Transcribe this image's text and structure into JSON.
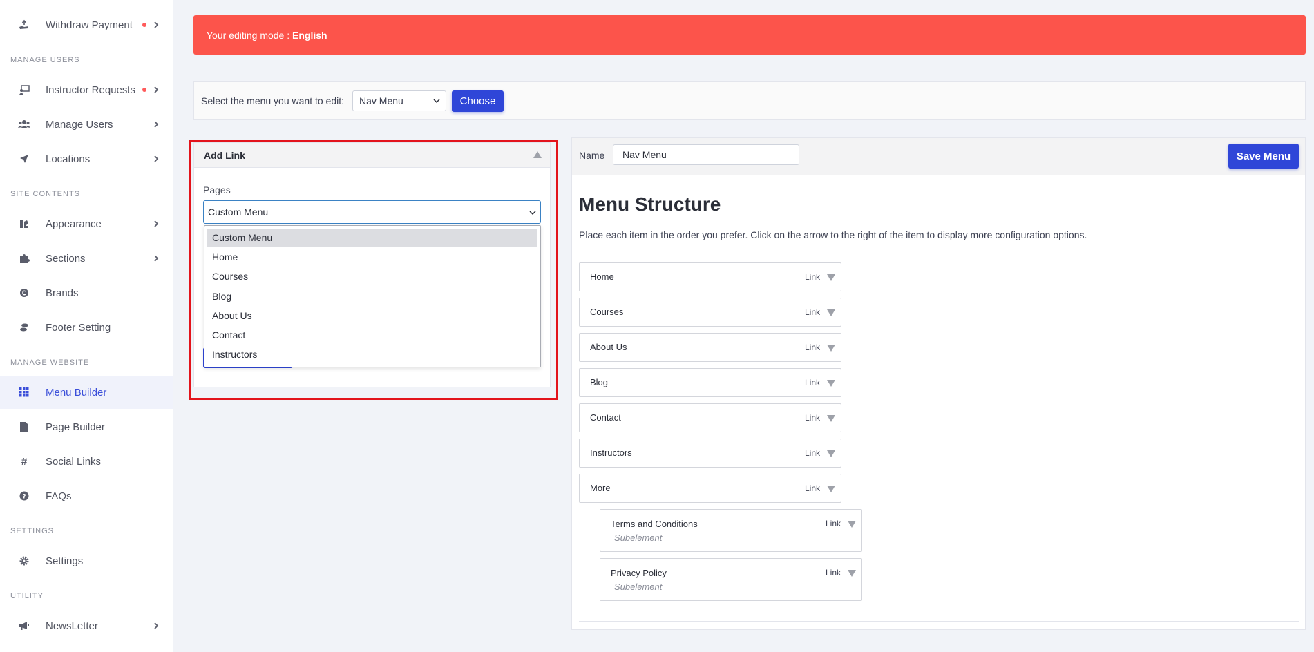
{
  "sidebar": {
    "sections": {
      "manage_users": "MANAGE USERS",
      "site_contents": "SITE CONTENTS",
      "manage_website": "MANAGE WEBSITE",
      "settings": "SETTINGS",
      "utility": "UTILITY"
    },
    "items": {
      "withdraw": "Withdraw Payment",
      "instructor_requests": "Instructor Requests",
      "manage_users": "Manage Users",
      "locations": "Locations",
      "appearance": "Appearance",
      "sections": "Sections",
      "brands": "Brands",
      "footer": "Footer Setting",
      "menu_builder": "Menu Builder",
      "page_builder": "Page Builder",
      "social_links": "Social Links",
      "faqs": "FAQs",
      "settings": "Settings",
      "newsletter": "NewsLetter"
    },
    "active": "menu_builder"
  },
  "alert": {
    "prefix": "Your editing mode : ",
    "language": "English",
    "color": "#fc544b"
  },
  "menu_select": {
    "label": "Select the menu you want to edit:",
    "value": "Nav Menu",
    "button": "Choose"
  },
  "add_link": {
    "title": "Add Link",
    "pages_label": "Pages",
    "selected": "Custom Menu",
    "options": [
      "Custom Menu",
      "Home",
      "Courses",
      "Blog",
      "About Us",
      "Contact",
      "Instructors"
    ]
  },
  "menu": {
    "name_label": "Name",
    "name_value": "Nav Menu",
    "save_button": "Save Menu",
    "structure_title": "Menu Structure",
    "description": "Place each item in the order you prefer. Click on the arrow to the right of the item to display more configuration options.",
    "items": [
      {
        "label": "Home",
        "type": "Link"
      },
      {
        "label": "Courses",
        "type": "Link"
      },
      {
        "label": "About Us",
        "type": "Link"
      },
      {
        "label": "Blog",
        "type": "Link"
      },
      {
        "label": "Contact",
        "type": "Link"
      },
      {
        "label": "Instructors",
        "type": "Link"
      },
      {
        "label": "More",
        "type": "Link"
      }
    ],
    "subitems": [
      {
        "label": "Terms and Conditions",
        "type": "Link",
        "note": "Subelement"
      },
      {
        "label": "Privacy Policy",
        "type": "Link",
        "note": "Subelement"
      }
    ]
  },
  "colors": {
    "accent": "#2f46d8",
    "highlight_border": "#e3141c",
    "notification_dot": "#ff5b5b"
  }
}
